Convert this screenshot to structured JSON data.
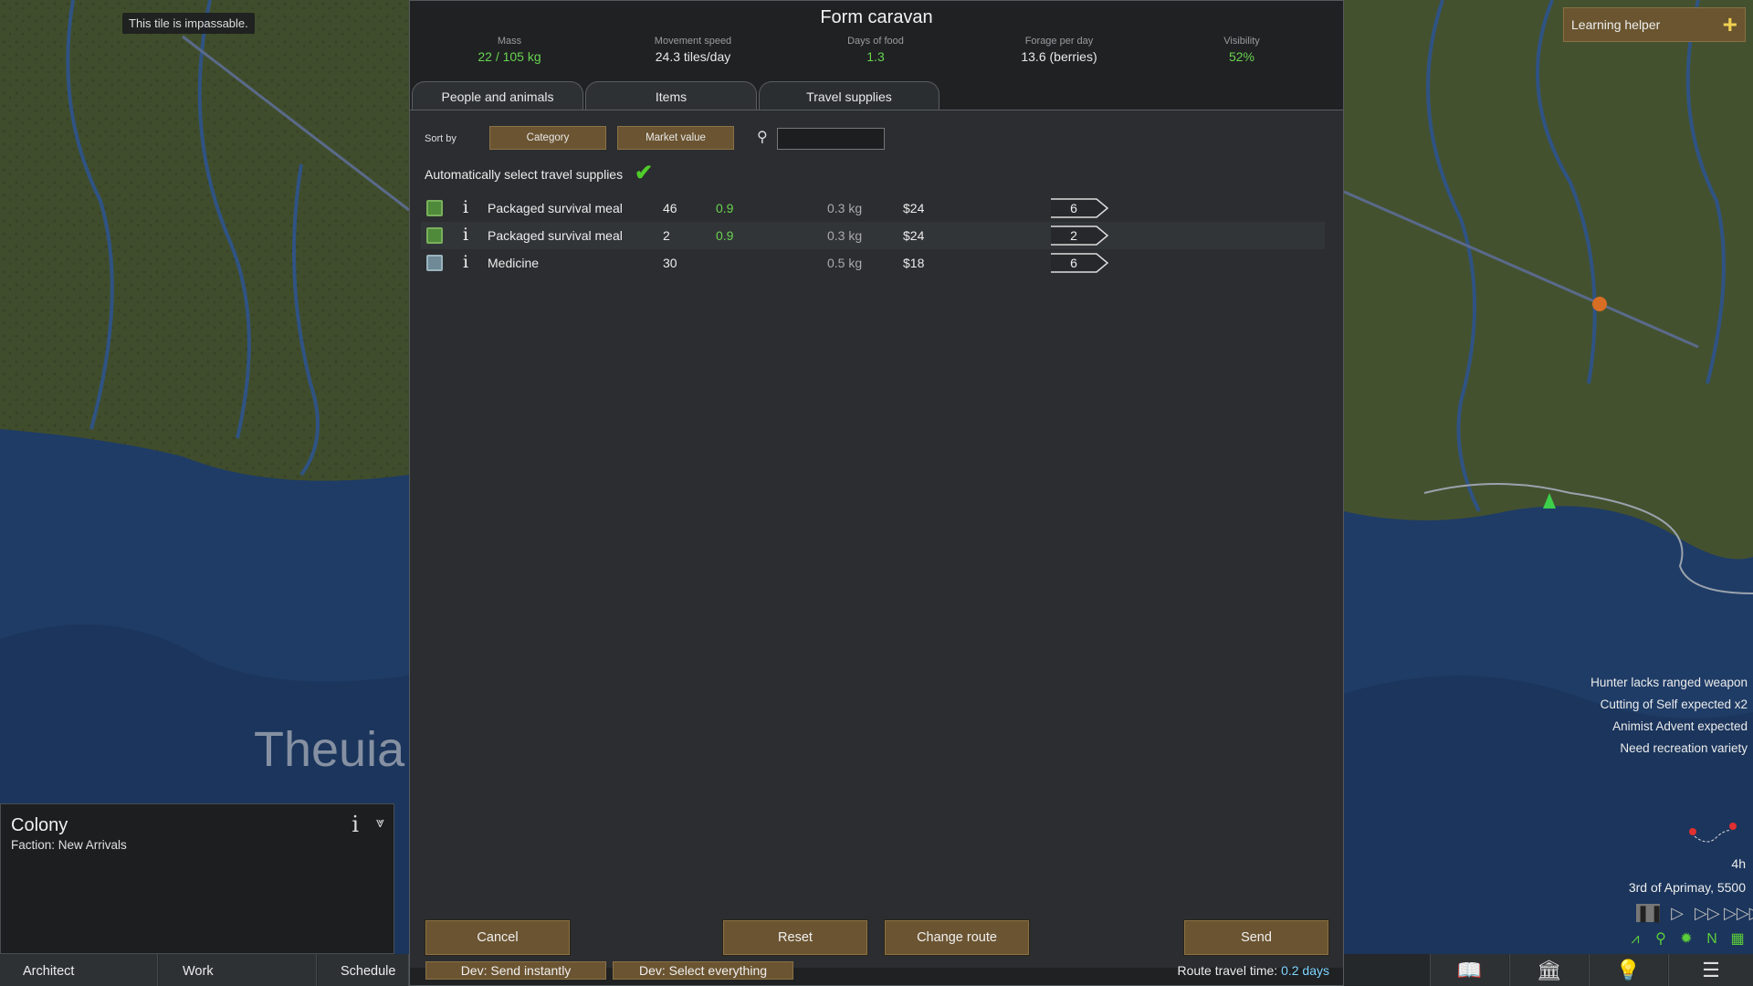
{
  "map": {
    "tooltip": "This tile is impassable.",
    "region_label": "Theuia"
  },
  "learning_helper": {
    "label": "Learning helper",
    "icon": "plus-icon"
  },
  "alerts": [
    "Hunter lacks ranged weapon",
    "Cutting of Self expected x2",
    "Animist Advent expected",
    "Need recreation variety"
  ],
  "clock": {
    "hour": "4h",
    "date": "3rd of Aprimay, 5500"
  },
  "inspector": {
    "title": "Colony",
    "faction": "Faction: New Arrivals"
  },
  "bottom_bar": {
    "tabs": [
      "Architect",
      "Work",
      "Schedule"
    ],
    "icons": [
      "book-icon",
      "factions-icon",
      "ideas-lightbulb-icon",
      "menu-list-icon"
    ]
  },
  "dialog": {
    "title": "Form caravan",
    "stats": [
      {
        "label": "Mass",
        "value": "22 / 105 kg",
        "green": true
      },
      {
        "label": "Movement speed",
        "value": "24.3 tiles/day",
        "green": false
      },
      {
        "label": "Days of food",
        "value": "1.3",
        "green": true
      },
      {
        "label": "Forage per day",
        "value": "13.6 (berries)",
        "green": false
      },
      {
        "label": "Visibility",
        "value": "52%",
        "green": true
      }
    ],
    "tabs": [
      "People and animals",
      "Items",
      "Travel supplies"
    ],
    "active_tab": "Travel supplies",
    "sort_by_label": "Sort by",
    "sort_buttons": [
      "Category",
      "Market value"
    ],
    "search": {
      "value": "",
      "placeholder": ""
    },
    "auto_select_label": "Automatically select travel supplies",
    "auto_select_checked": true,
    "rows": [
      {
        "name": "Packaged survival meal",
        "count": "46",
        "days": "0.9",
        "mass": "0.3 kg",
        "price": "$24",
        "qty": "6",
        "icon_color": "#4f8a3a"
      },
      {
        "name": "Packaged survival meal",
        "count": "2",
        "days": "0.9",
        "mass": "0.3 kg",
        "price": "$24",
        "qty": "2",
        "icon_color": "#4f8a3a"
      },
      {
        "name": "Medicine",
        "count": "30",
        "days": "",
        "mass": "0.5 kg",
        "price": "$18",
        "qty": "6",
        "icon_color": "#6f8a96"
      }
    ],
    "buttons": {
      "cancel": "Cancel",
      "reset": "Reset",
      "change_route": "Change route",
      "send": "Send"
    },
    "dev_buttons": [
      "Dev: Send instantly",
      "Dev: Select everything"
    ],
    "route_label": "Route travel time:",
    "route_value": "0.2 days"
  },
  "colors": {
    "accent_button": "#6b5431",
    "positive_green": "#69d34f",
    "route_value": "#7fd4ff"
  }
}
